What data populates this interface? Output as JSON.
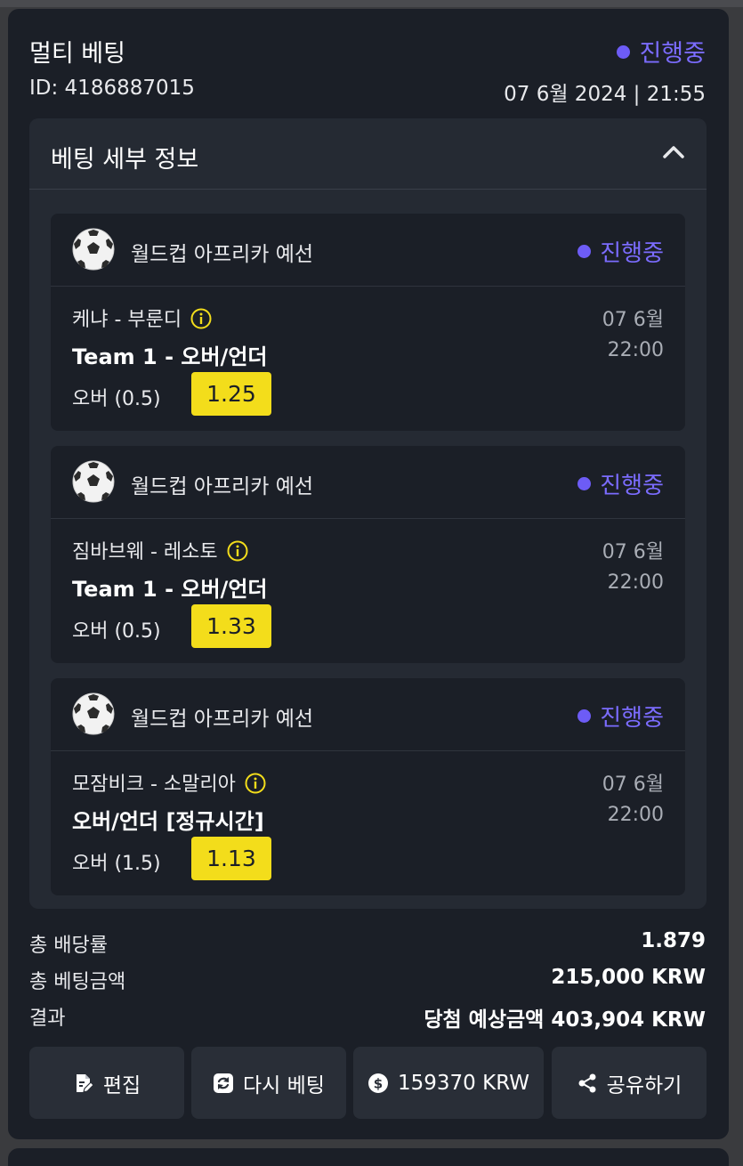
{
  "header": {
    "title": "멀티 베팅",
    "status": "진행중",
    "bet_id": "ID: 4186887015",
    "datetime": "07 6월 2024 | 21:55"
  },
  "details": {
    "title": "베팅 세부 정보",
    "toggle_icon": "chevron-up-icon"
  },
  "bets": [
    {
      "sport_icon": "soccer-ball-icon",
      "league": "월드컵 아프리카 예선",
      "status": "진행중",
      "match": "케냐 - 부룬디",
      "market": "Team 1 - 오버/언더",
      "pick": "오버 (0.5)",
      "odds": "1.25",
      "date": "07 6월",
      "time": "22:00"
    },
    {
      "sport_icon": "soccer-ball-icon",
      "league": "월드컵 아프리카 예선",
      "status": "진행중",
      "match": "짐바브웨 - 레소토",
      "market": "Team 1 - 오버/언더",
      "pick": "오버 (0.5)",
      "odds": "1.33",
      "date": "07 6월",
      "time": "22:00"
    },
    {
      "sport_icon": "soccer-ball-icon",
      "league": "월드컵 아프리카 예선",
      "status": "진행중",
      "match": "모잠비크 - 소말리아",
      "market": "오버/언더 [정규시간]",
      "pick": "오버 (1.5)",
      "odds": "1.13",
      "date": "07 6월",
      "time": "22:00"
    }
  ],
  "summary": {
    "total_odds_label": "총 배당률",
    "total_odds_value": "1.879",
    "total_stake_label": "총 베팅금액",
    "total_stake_value": "215,000 KRW",
    "result_label": "결과",
    "result_value": "당첨 예상금액 403,904 KRW"
  },
  "actions": {
    "edit": "편집",
    "rebet": "다시 베팅",
    "cashout": "159370 KRW",
    "share": "공유하기"
  },
  "colors": {
    "accent": "#6d5cf6",
    "odds_bg": "#f3dd1b",
    "card_bg": "#1b1f27",
    "panel_bg": "#252a33"
  }
}
